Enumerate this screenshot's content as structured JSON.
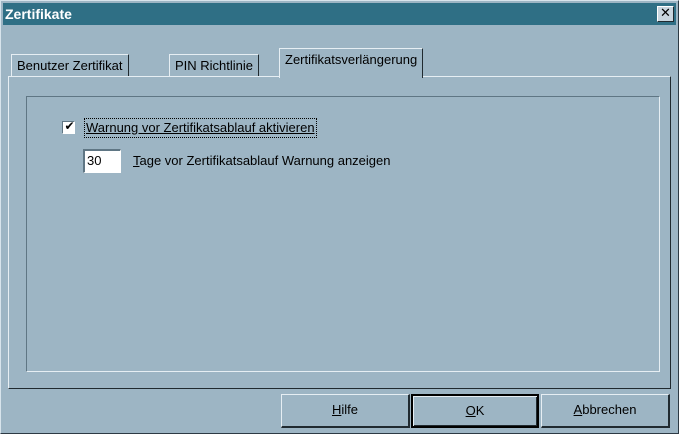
{
  "window": {
    "title": "Zertifikate",
    "close_icon": "close-icon"
  },
  "tabs": [
    {
      "label": "Benutzer Zertifikat",
      "active": false
    },
    {
      "label": "PIN Richtlinie",
      "active": false
    },
    {
      "label": "Zertifikatsverlängerung",
      "active": true
    }
  ],
  "settings": {
    "warn_checkbox_checked": true,
    "warn_label": "Warnung vor Zertifikatsablauf aktivieren",
    "days_value": "30",
    "days_label_mnemonic": "T",
    "days_label_rest": "age vor Zertifikatsablauf Warnung anzeigen"
  },
  "buttons": {
    "help_mnemonic": "H",
    "help_rest": "ilfe",
    "ok_mnemonic": "O",
    "ok_rest": "K",
    "cancel_mnemonic": "A",
    "cancel_rest": "bbrechen"
  },
  "colors": {
    "titlebar": "#2f6f85",
    "face": "#9db5c4"
  }
}
